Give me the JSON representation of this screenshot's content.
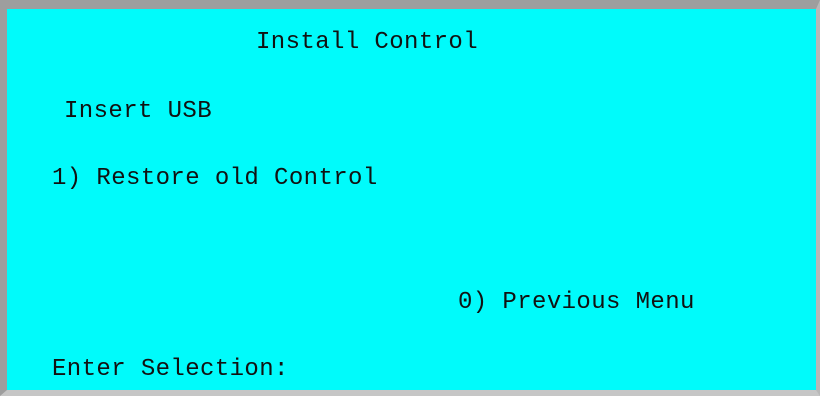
{
  "screen": {
    "title": "Install Control",
    "instruction": "Insert USB",
    "options": [
      {
        "label": "1) Restore old Control"
      },
      {
        "label": "0) Previous Menu"
      }
    ],
    "prompt": "Enter Selection:"
  },
  "colors": {
    "background": "#00fbfb",
    "text": "#111111",
    "frame": "#9e9e9e"
  }
}
